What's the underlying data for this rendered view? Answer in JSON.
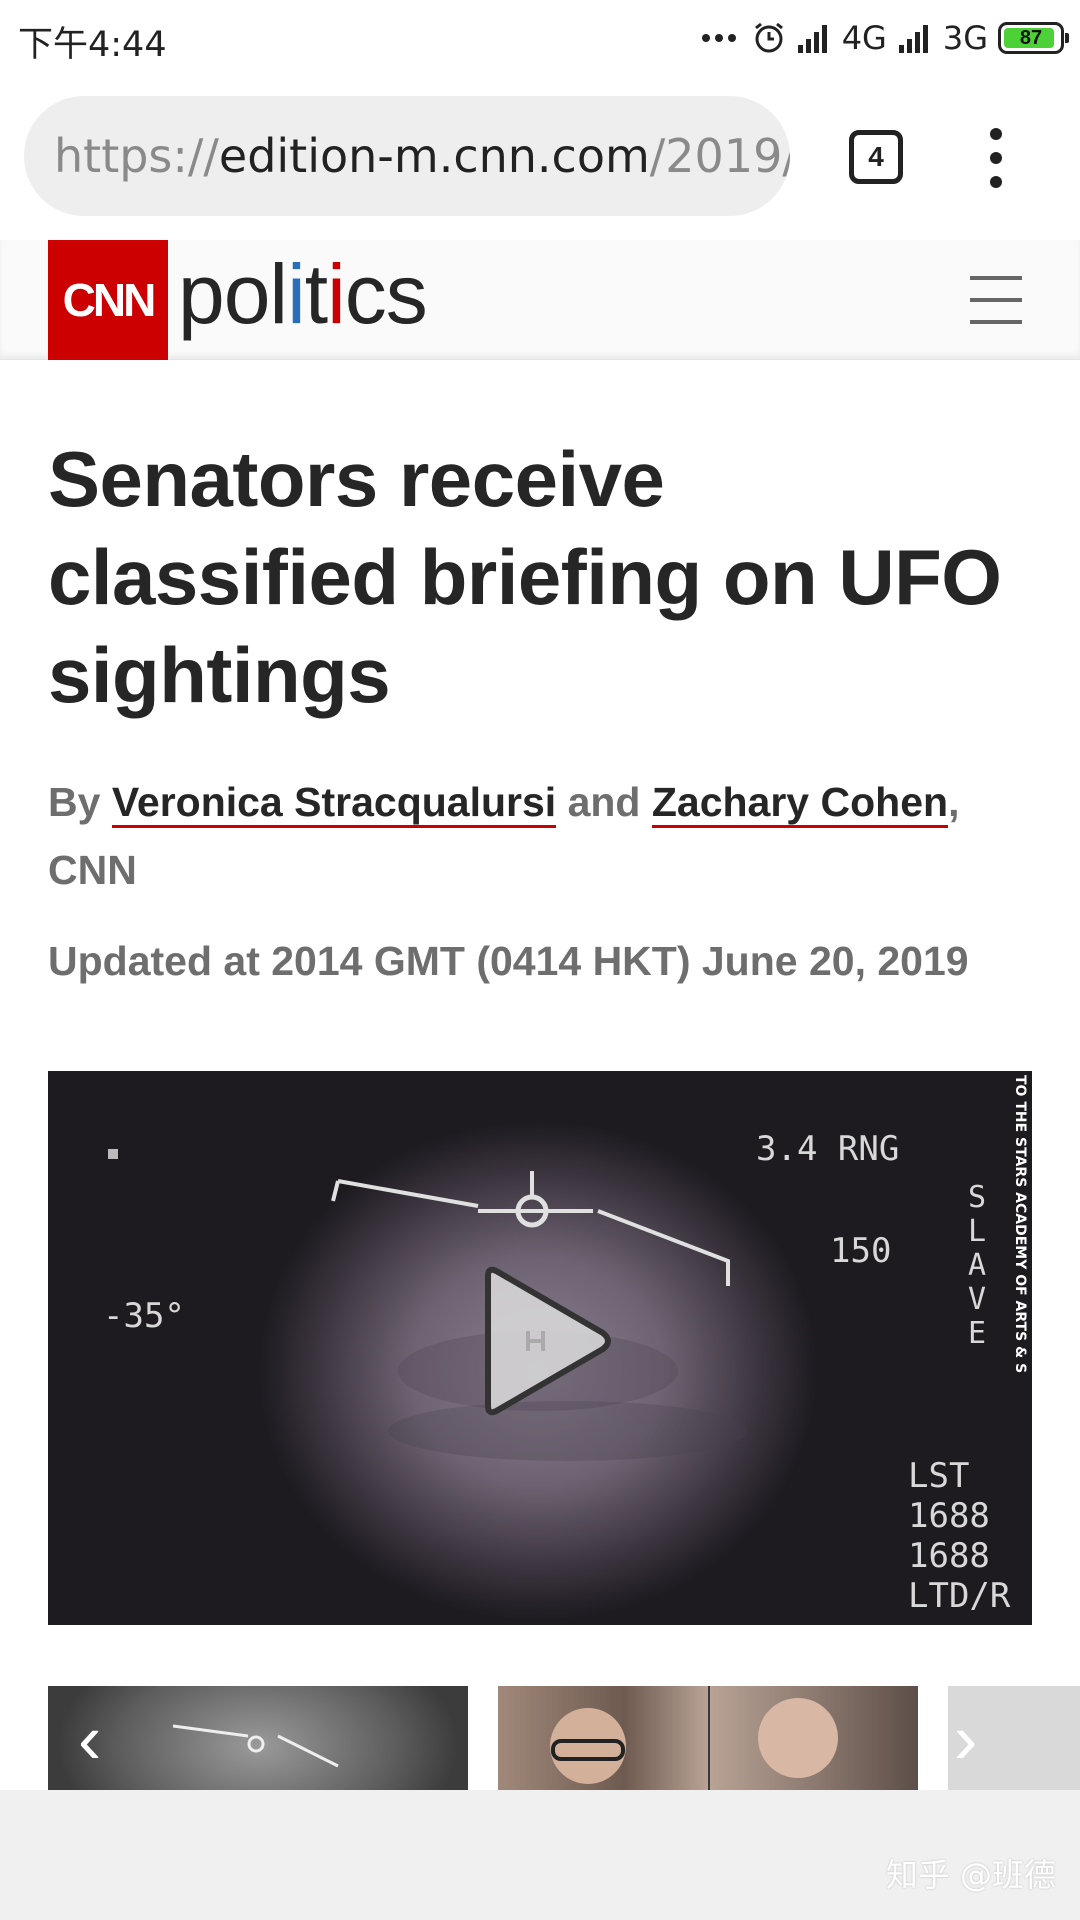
{
  "status_bar": {
    "time": "下午4:44",
    "network_1": "4G",
    "network_2": "3G",
    "battery": "87"
  },
  "browser": {
    "url_prefix": "https://",
    "url_host": "edition-m.cnn.com",
    "url_path": "/2019/",
    "tab_count": "4"
  },
  "site": {
    "logo_text": "CNN",
    "section_p1": "pol",
    "section_i1": "i",
    "section_t": "t",
    "section_i2": "i",
    "section_end": "cs"
  },
  "article": {
    "headline": "Senators receive classified briefing on UFO sightings",
    "byline_by": "By ",
    "author_1": "Veronica Stracqualursi",
    "byline_and": " and ",
    "author_2": "Zachary Cohen",
    "byline_source": ", CNN",
    "updated": "Updated at 2014 GMT (0414 HKT) June 20, 2019"
  },
  "video": {
    "overlay_range": "3.4 RNG",
    "overlay_speed": "150",
    "overlay_angle": "-35°",
    "overlay_slave": "SLAVE",
    "overlay_lst": "LST",
    "overlay_1688a": "1688",
    "overlay_1688b": "1688",
    "overlay_ltd": "LTD/R",
    "credit": "TO THE STARS ACADEMY OF ARTS & S"
  },
  "watermark": "知乎 @班德",
  "colors": {
    "cnn_red": "#cc0000",
    "politics_blue": "#2a6ebb",
    "battery_green": "#4cd137"
  }
}
